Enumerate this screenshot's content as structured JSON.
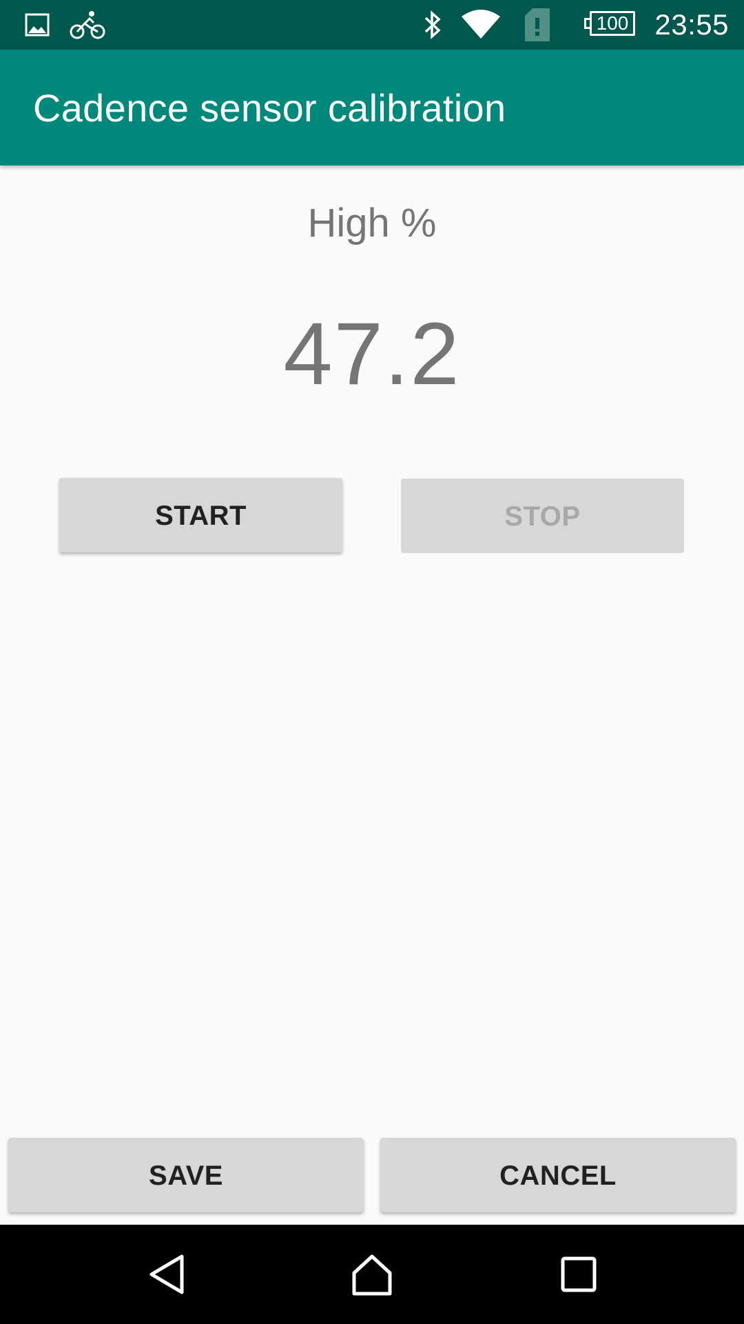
{
  "status_bar": {
    "time": "23:55",
    "battery_level": "100",
    "icons": [
      "image-icon",
      "bike-icon",
      "bluetooth-icon",
      "wifi-icon",
      "sim-alert-icon",
      "battery-icon"
    ],
    "colors": {
      "background": "#00574e"
    }
  },
  "app_bar": {
    "title": "Cadence sensor calibration",
    "colors": {
      "background": "#00897b"
    }
  },
  "main": {
    "metric_label": "High %",
    "metric_value": "47.2",
    "start_label": "START",
    "stop_label": "STOP"
  },
  "footer": {
    "save_label": "SAVE",
    "cancel_label": "CANCEL"
  },
  "nav_bar": {
    "icons": [
      "back-icon",
      "home-icon",
      "recents-icon"
    ]
  }
}
